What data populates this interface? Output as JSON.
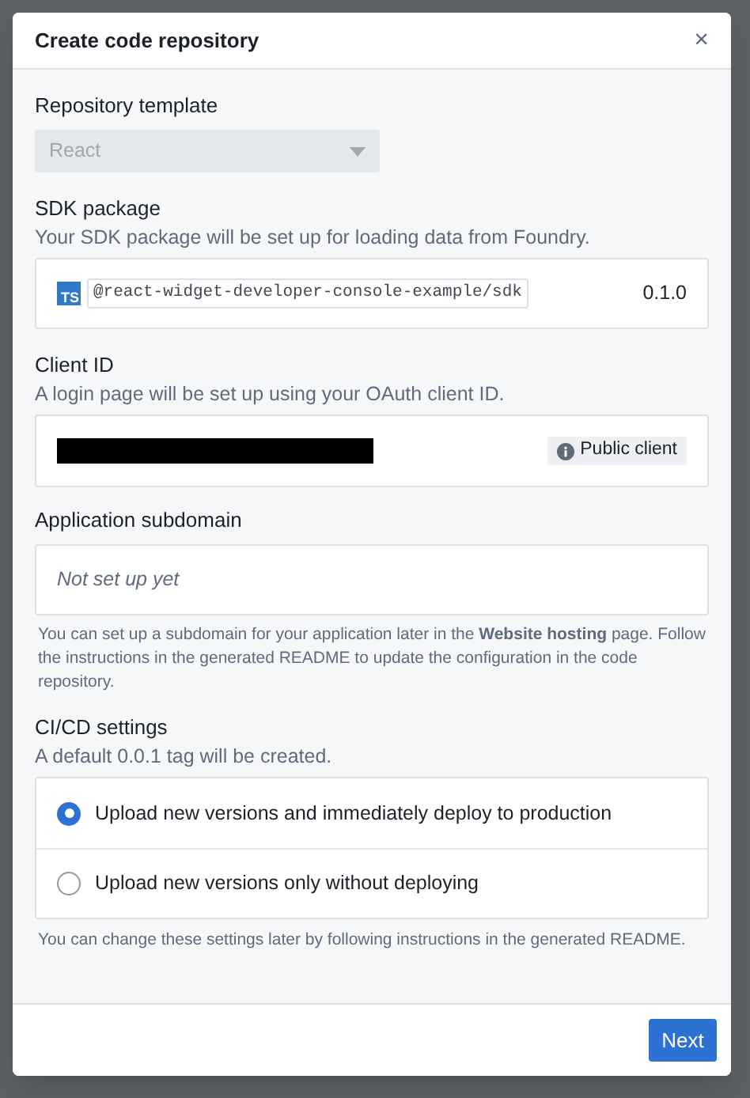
{
  "dialog": {
    "title": "Create code repository",
    "close": "×"
  },
  "template": {
    "label": "Repository template",
    "value": "React",
    "disabled": true
  },
  "sdk": {
    "label": "SDK package",
    "description": "Your SDK package will be set up for loading data from Foundry.",
    "badge": "TS",
    "package": "@react-widget-developer-console-example/sdk",
    "version": "0.1.0"
  },
  "client": {
    "label": "Client ID",
    "description": "A login page will be set up using your OAuth client ID.",
    "redacted": true,
    "tag": "Public client"
  },
  "subdomain": {
    "label": "Application subdomain",
    "placeholder": "Not set up yet",
    "help": "You can set up a subdomain for your application later in the **Website hosting** page. Follow the instructions in the generated README to update the configuration in the code repository."
  },
  "cicd": {
    "label": "CI/CD settings",
    "description": "A default 0.0.1 tag will be created.",
    "options": [
      {
        "label": "Upload new versions and immediately deploy to production",
        "selected": true
      },
      {
        "label": "Upload new versions only without deploying",
        "selected": false
      }
    ],
    "help": "You can change these settings later by following instructions in the generated README."
  },
  "footer": {
    "button": "Next"
  }
}
